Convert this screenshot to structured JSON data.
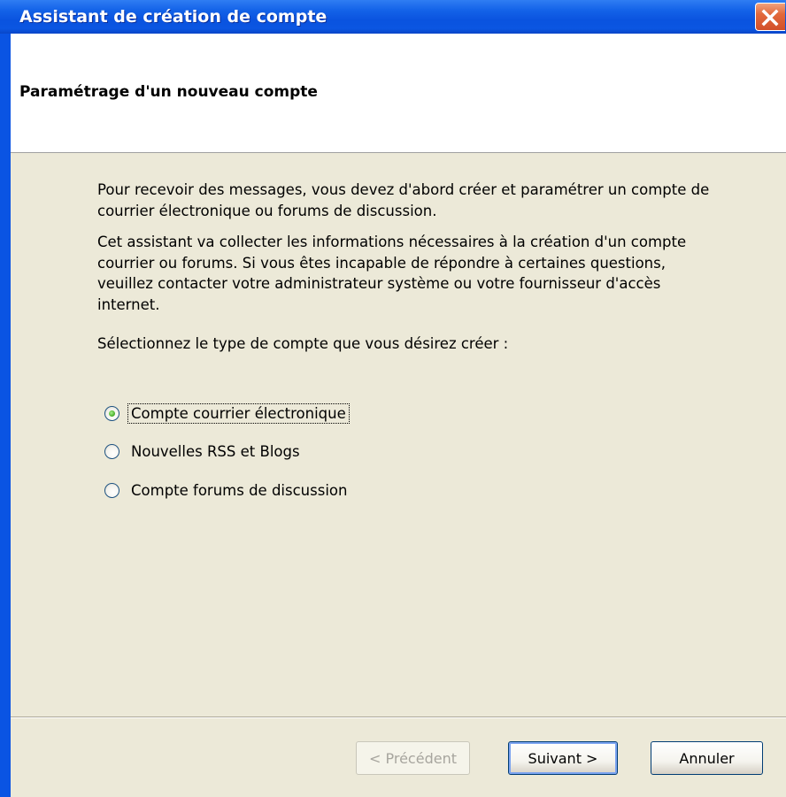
{
  "window": {
    "title": "Assistant de création de compte"
  },
  "header": {
    "title": "Paramétrage d'un nouveau compte"
  },
  "body": {
    "paragraph1": "Pour recevoir des messages, vous devez d'abord créer et paramétrer un compte de courrier électronique ou forums de discussion.",
    "paragraph2": "Cet assistant va collecter les informations nécessaires à la création d'un compte courrier ou forums. Si vous êtes incapable de répondre à certaines questions, veuillez contacter votre administrateur système ou votre fournisseur d'accès internet.",
    "prompt": "Sélectionnez le type de compte que vous désirez créer :"
  },
  "options": [
    {
      "label": "Compte courrier électronique",
      "checked": true
    },
    {
      "label": "Nouvelles RSS et Blogs",
      "checked": false
    },
    {
      "label": "Compte forums de discussion",
      "checked": false
    }
  ],
  "buttons": {
    "prev": "< Précédent",
    "next": "Suivant >",
    "cancel": "Annuler"
  },
  "colors": {
    "titlebar": "#0a54e3",
    "close": "#e2693b",
    "panel": "#ece9d8",
    "selected_radio": "#4fb431"
  }
}
